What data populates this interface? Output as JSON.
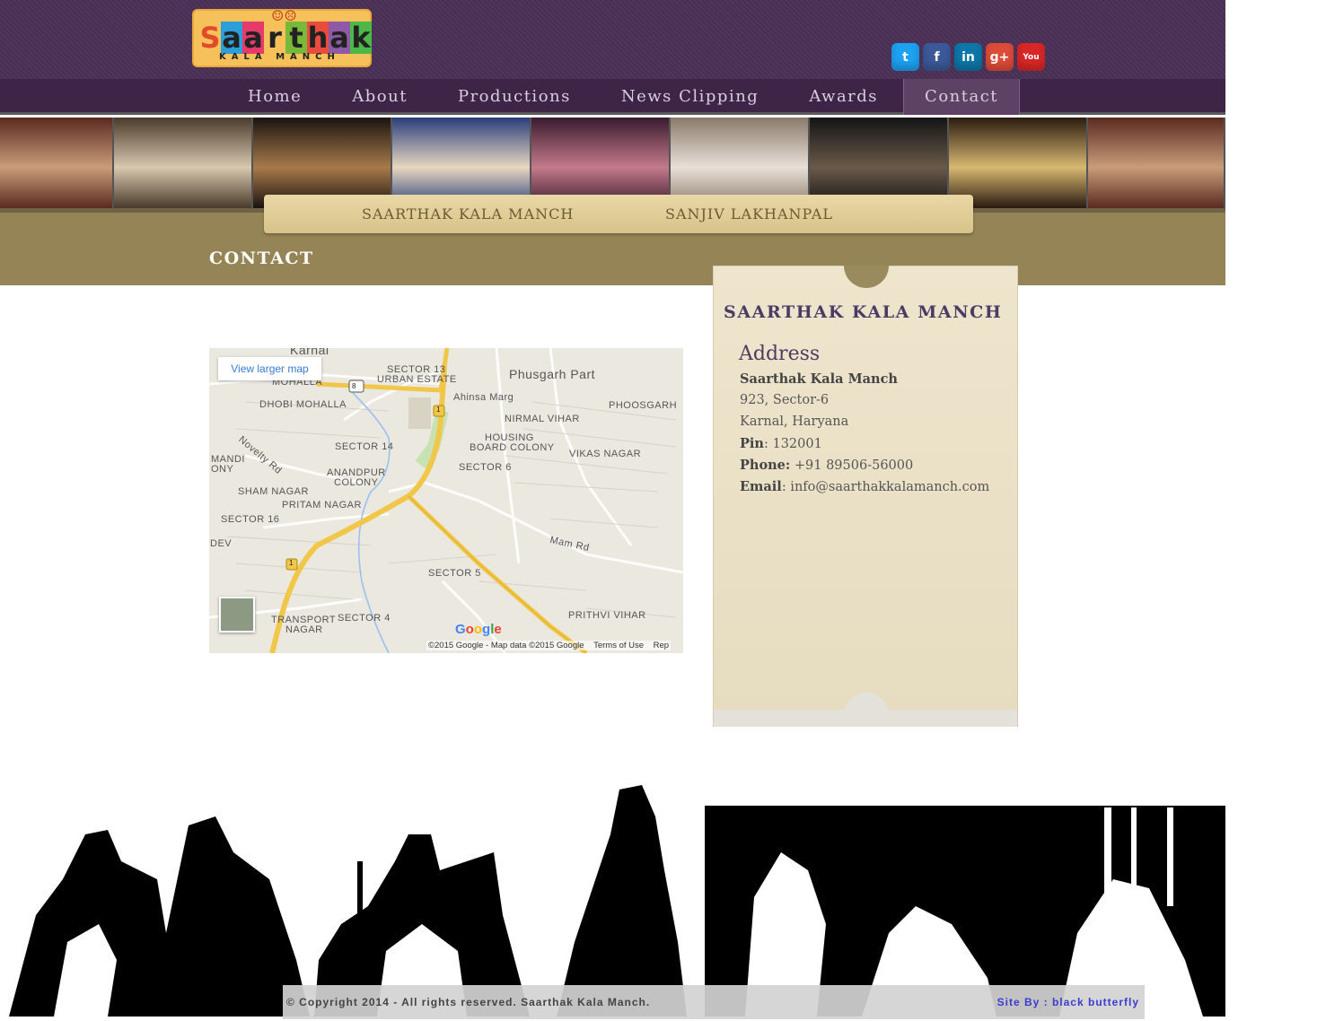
{
  "header": {
    "logo": {
      "word": "Saarthak",
      "sub": "KALA MANCH"
    },
    "social": [
      {
        "name": "twitter-icon",
        "glyph": "t",
        "color": "#1da1f2"
      },
      {
        "name": "facebook-icon",
        "glyph": "f",
        "color": "#3b5998"
      },
      {
        "name": "linkedin-icon",
        "glyph": "in",
        "color": "#0e76a8"
      },
      {
        "name": "googleplus-icon",
        "glyph": "g+",
        "color": "#dd4b39"
      },
      {
        "name": "youtube-icon",
        "glyph": "You",
        "color": "#d92626"
      }
    ]
  },
  "nav": {
    "items": [
      "Home",
      "About",
      "Productions",
      "News Clipping",
      "Awards",
      "Contact"
    ],
    "active": "Contact"
  },
  "subnav": {
    "left": "SAARTHAK KALA MANCH",
    "right": "SANJIV LAKHANPAL"
  },
  "page": {
    "title": "CONTACT"
  },
  "map": {
    "view_larger": "View larger map",
    "attribution": "©2015 Google - Map data ©2015 Google",
    "terms": "Terms of Use",
    "report": "Rep",
    "google": "Google",
    "labels": [
      "Karnal",
      "MOHALLA",
      "SECTOR 13",
      "URBAN ESTATE",
      "Phusgarh Part",
      "Ahinsa Marg",
      "DHOBI MOHALLA",
      "NIRMAL VIHAR",
      "PHOOSGARH",
      "HOUSING",
      "BOARD COLONY",
      "SECTOR 14",
      "Novelty Rd",
      "MANDI",
      "ONY",
      "ANANDPUR",
      "COLONY",
      "SECTOR 6",
      "VIKAS NAGAR",
      "SHAM NAGAR",
      "PRITAM NAGAR",
      "SECTOR 16",
      "DEV",
      "Mam Rd",
      "SECTOR 5",
      "TRANSPORT",
      "NAGAR",
      "SECTOR 4",
      "PRITHVI VIHAR"
    ],
    "shields": [
      "8",
      "1",
      "1"
    ]
  },
  "contact": {
    "org": "SAARTHAK KALA MANCH",
    "heading": "Address",
    "name": "Saarthak Kala Manch",
    "line1": "923, Sector-6",
    "line2": "Karnal, Haryana",
    "pin_label": "Pin",
    "pin": ": 132001",
    "phone_label": "Phone:",
    "phone": " +91 89506-56000",
    "email_label": "Email",
    "email": ": info@saarthakkalamanch.com"
  },
  "footer": {
    "copyright": "© Copyright 2014 - All rights reserved. Saarthak Kala Manch.",
    "site_by": "Site By : black butterfly"
  }
}
